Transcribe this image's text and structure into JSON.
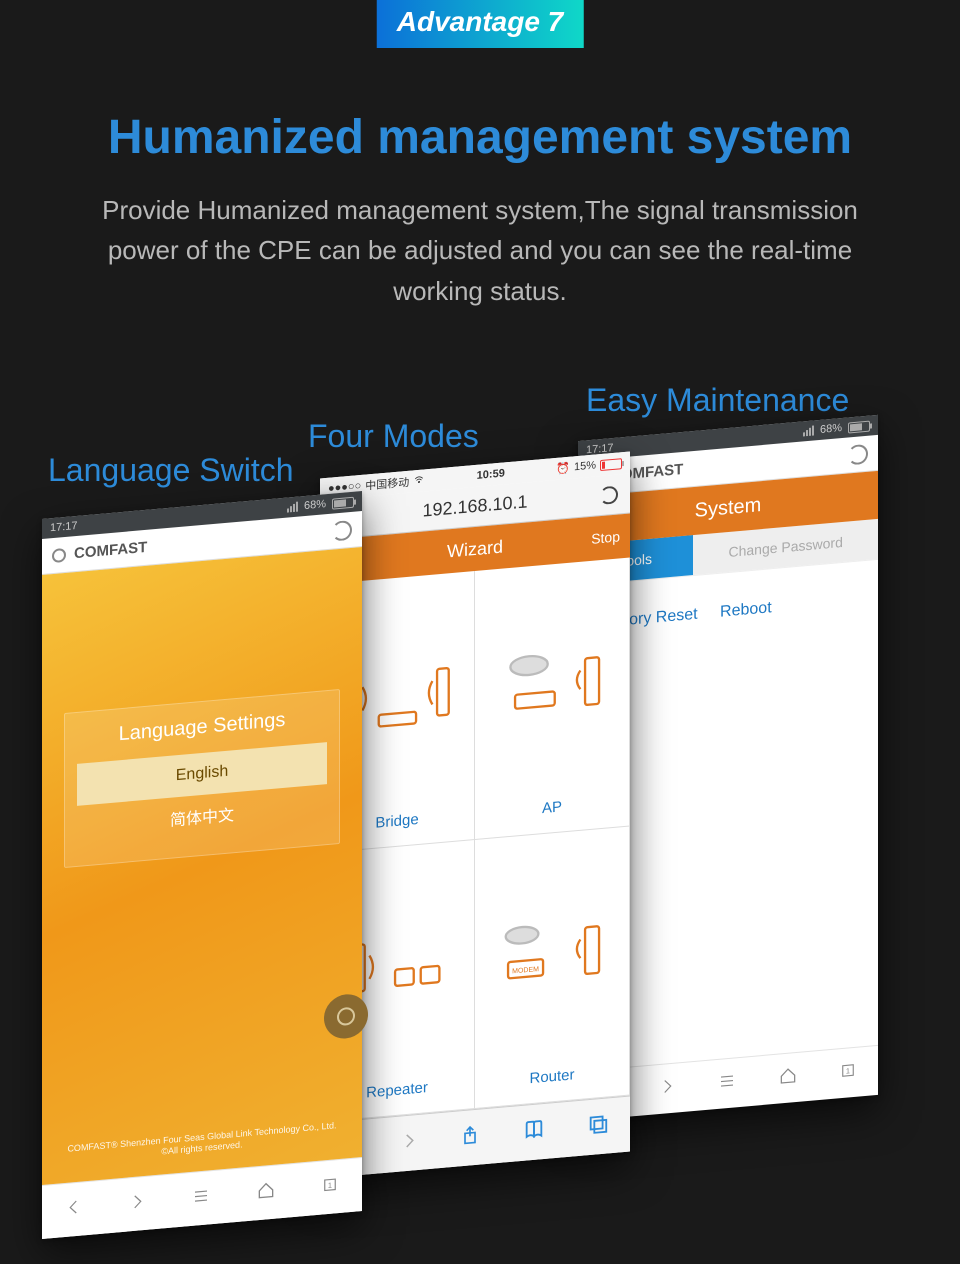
{
  "badge": "Advantage 7",
  "headline": "Humanized management system",
  "subhead": "Provide Humanized management system,The signal transmission power of the CPE can be adjusted and you can see the real-time working status.",
  "phone1": {
    "label": "Language Switch",
    "status": {
      "time": "17:17",
      "battery": "68%"
    },
    "brand": "COMFAST",
    "card_title": "Language Settings",
    "opt_selected": "English",
    "opt_alt": "简体中文",
    "copyright_l1": "COMFAST® Shenzhen Four Seas Global Link Technology Co., Ltd.",
    "copyright_l2": "©All rights reserved."
  },
  "phone2": {
    "label": "Four Modes",
    "status": {
      "carrier": "中国移动",
      "time": "10:59",
      "battery": "15%"
    },
    "url": "192.168.10.1",
    "header": "Wizard",
    "stop": "Stop",
    "modes": {
      "bridge": "Bridge",
      "ap": "AP",
      "repeater": "Repeater",
      "router": "Router"
    }
  },
  "phone3": {
    "label": "Easy Maintenance",
    "status": {
      "time": "17:17",
      "battery": "68%"
    },
    "brand": "COMFAST",
    "header": "System",
    "tab_active": "Tools",
    "tab_inactive": "Change Password",
    "link1": "Factory Reset",
    "link2": "Reboot"
  }
}
